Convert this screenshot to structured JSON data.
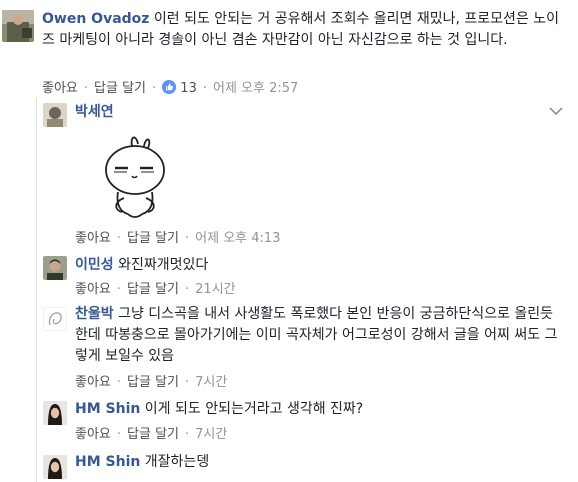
{
  "comments": [
    {
      "author": "Owen Ovadoz",
      "text": "이런 되도 안되는 거 공유해서 조회수 올리면 재밌나, 프로모션은 노이즈 마케팅이 아니라 경솔이 아닌 겸손 자만감이 아닌 자신감으로 하는 것 입니다.",
      "like": "좋아요",
      "reply": "답글 달기",
      "reaction_count": "13",
      "time": "어제 오후 2:57"
    },
    {
      "author": "박세연",
      "like": "좋아요",
      "reply": "답글 달기",
      "time": "어제 오후 4:13"
    },
    {
      "author": "이민성",
      "text": "와진짜개멋있다",
      "like": "좋아요",
      "reply": "답글 달기",
      "time": "21시간"
    },
    {
      "author": "찬울박",
      "text": "그냥 디스곡을 내서 사생활도 폭로했다 본인 반응이 궁금하단식으로 올린듯 한데 따봉충으로 몰아가기에는 이미 곡자체가 어그로성이 강해서 글을 어찌 써도 그렇게 보일수 있음",
      "like": "좋아요",
      "reply": "답글 달기",
      "time": "7시간"
    },
    {
      "author": "HM Shin",
      "text": "이게 되도 안되는거라고 생각해 진짜?",
      "like": "좋아요",
      "reply": "답글 달기",
      "time": "7시간"
    },
    {
      "author": "HM Shin",
      "text": "개잘하는뎅"
    }
  ],
  "separator": "·",
  "colors": {
    "link": "#365899",
    "meta": "#90949c",
    "like_blue": "#5890ff"
  }
}
